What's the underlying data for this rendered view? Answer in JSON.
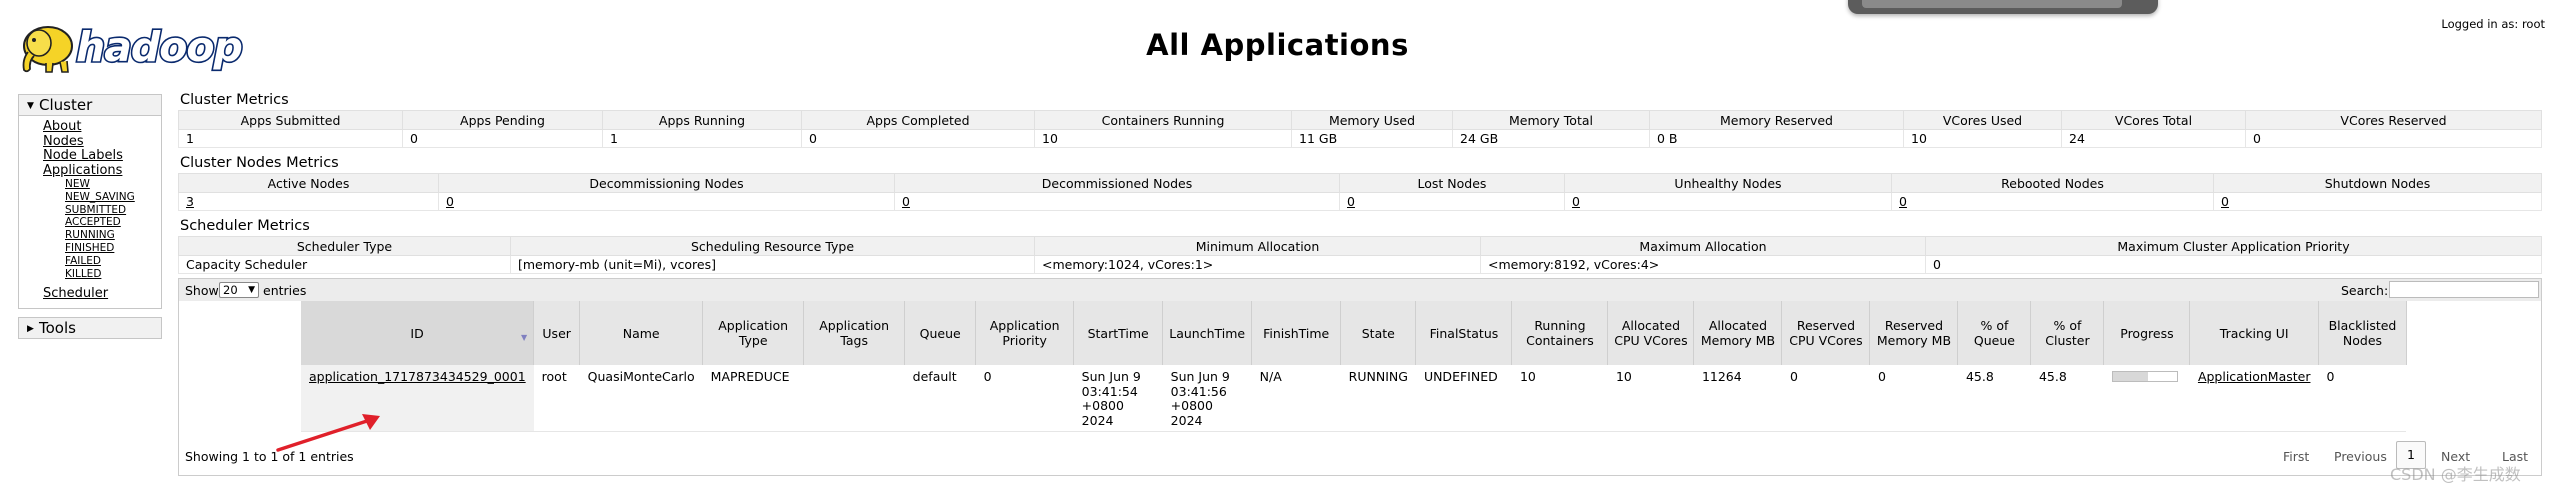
{
  "header": {
    "logo_text": "hadoop",
    "title": "All Applications",
    "logged_in": "Logged in as: root"
  },
  "sidebar": {
    "cluster_label": "Cluster",
    "cluster_links": [
      "About",
      "Nodes",
      "Node Labels",
      "Applications"
    ],
    "app_states": [
      "NEW",
      "NEW_SAVING",
      "SUBMITTED",
      "ACCEPTED",
      "RUNNING",
      "FINISHED",
      "FAILED",
      "KILLED"
    ],
    "scheduler_label": "Scheduler",
    "tools_label": "Tools"
  },
  "cluster_metrics": {
    "title": "Cluster Metrics",
    "headers": [
      "Apps Submitted",
      "Apps Pending",
      "Apps Running",
      "Apps Completed",
      "Containers Running",
      "Memory Used",
      "Memory Total",
      "Memory Reserved",
      "VCores Used",
      "VCores Total",
      "VCores Reserved"
    ],
    "values": [
      "1",
      "0",
      "1",
      "0",
      "10",
      "11 GB",
      "24 GB",
      "0 B",
      "10",
      "24",
      "0"
    ]
  },
  "node_metrics": {
    "title": "Cluster Nodes Metrics",
    "headers": [
      "Active Nodes",
      "Decommissioning Nodes",
      "Decommissioned Nodes",
      "Lost Nodes",
      "Unhealthy Nodes",
      "Rebooted Nodes",
      "Shutdown Nodes"
    ],
    "values": [
      "3",
      "0",
      "0",
      "0",
      "0",
      "0",
      "0"
    ]
  },
  "scheduler_metrics": {
    "title": "Scheduler Metrics",
    "headers": [
      "Scheduler Type",
      "Scheduling Resource Type",
      "Minimum Allocation",
      "Maximum Allocation",
      "Maximum Cluster Application Priority"
    ],
    "values": [
      "Capacity Scheduler",
      "[memory-mb (unit=Mi), vcores]",
      "<memory:1024, vCores:1>",
      "<memory:8192, vCores:4>",
      "0"
    ]
  },
  "table_controls": {
    "show_label": "Show",
    "entries_value": "20",
    "entries_label": "entries",
    "search_label": "Search:",
    "search_value": "",
    "info": "Showing 1 to 1 of 1 entries",
    "pager": {
      "first": "First",
      "previous": "Previous",
      "current": "1",
      "next": "Next",
      "last": "Last"
    }
  },
  "apps_table": {
    "headers": [
      "ID",
      "User",
      "Name",
      "Application Type",
      "Application Tags",
      "Queue",
      "Application Priority",
      "StartTime",
      "LaunchTime",
      "FinishTime",
      "State",
      "FinalStatus",
      "Running Containers",
      "Allocated CPU VCores",
      "Allocated Memory MB",
      "Reserved CPU VCores",
      "Reserved Memory MB",
      "% of Queue",
      "% of Cluster",
      "Progress",
      "Tracking UI",
      "Blacklisted Nodes"
    ],
    "rows": [
      {
        "id": "application_1717873434529_0001",
        "user": "root",
        "name": "QuasiMonteCarlo",
        "type": "MAPREDUCE",
        "tags": "",
        "queue": "default",
        "priority": "0",
        "start_time": "Sun Jun 9 03:41:54 +0800 2024",
        "launch_time": "Sun Jun 9 03:41:56 +0800 2024",
        "finish_time": "N/A",
        "state": "RUNNING",
        "final_status": "UNDEFINED",
        "running_containers": "10",
        "alloc_vcores": "10",
        "alloc_memory": "11264",
        "reserved_vcores": "0",
        "reserved_memory": "0",
        "pct_queue": "45.8",
        "pct_cluster": "45.8",
        "progress": 0.55,
        "tracking_ui": "ApplicationMaster",
        "blacklisted": "0"
      }
    ]
  },
  "watermark": "CSDN @李生成数",
  "colors": {
    "header_bg": "#f1f1f1",
    "border": "#e0e0e0",
    "annotation_arrow": "#e0202a",
    "logo_yellow": "#f5d327"
  }
}
